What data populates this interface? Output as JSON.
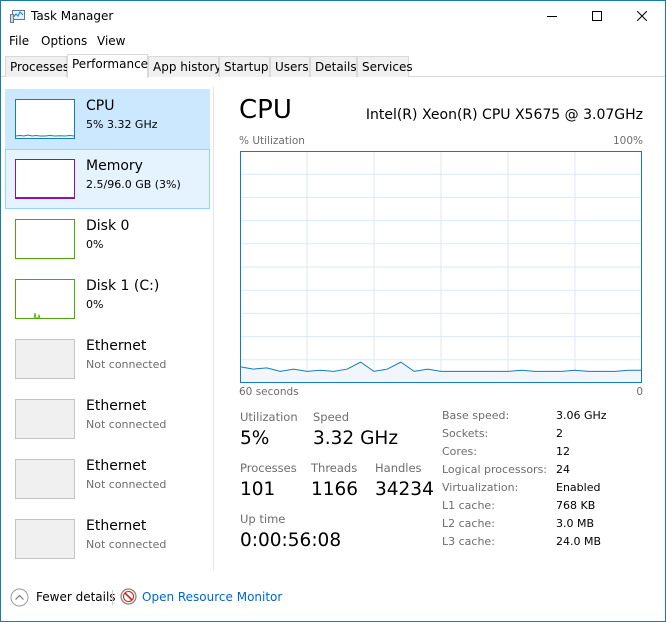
{
  "window": {
    "title": "Task Manager",
    "app_icon": "task-manager-icon",
    "controls": [
      "minimize-icon",
      "maximize-icon",
      "close-icon"
    ]
  },
  "menu": [
    "File",
    "Options",
    "View"
  ],
  "tabs": [
    {
      "label": "Processes",
      "active": false
    },
    {
      "label": "Performance",
      "active": true
    },
    {
      "label": "App history",
      "active": false
    },
    {
      "label": "Startup",
      "active": false
    },
    {
      "label": "Users",
      "active": false
    },
    {
      "label": "Details",
      "active": false
    },
    {
      "label": "Services",
      "active": false
    }
  ],
  "sidebar": {
    "items": [
      {
        "title": "CPU",
        "subtitle": "5% 3.32 GHz",
        "state": "selected",
        "color": "#117dbb"
      },
      {
        "title": "Memory",
        "subtitle": "2.5/96.0 GB (3%)",
        "state": "hover",
        "color": "#8b12ae"
      },
      {
        "title": "Disk 0",
        "subtitle": "0%",
        "state": "normal",
        "color": "#4da60c"
      },
      {
        "title": "Disk 1 (C:)",
        "subtitle": "0%",
        "state": "normal",
        "color": "#4da60c"
      },
      {
        "title": "Ethernet",
        "subtitle": "Not connected",
        "state": "disabled",
        "color": "#c4c4c4"
      },
      {
        "title": "Ethernet",
        "subtitle": "Not connected",
        "state": "disabled",
        "color": "#c4c4c4"
      },
      {
        "title": "Ethernet",
        "subtitle": "Not connected",
        "state": "disabled",
        "color": "#c4c4c4"
      },
      {
        "title": "Ethernet",
        "subtitle": "Not connected",
        "state": "disabled",
        "color": "#c4c4c4"
      }
    ]
  },
  "main": {
    "heading": "CPU",
    "model": "Intel(R) Xeon(R) CPU X5675 @ 3.07GHz",
    "graph": {
      "y_label": "% Utilization",
      "y_max_label": "100%",
      "x_left_label": "60 seconds",
      "x_right_label": "0",
      "line_color": "#117dbb",
      "fill_color": "#f1f6fa",
      "grid_color": "#d9eaf4"
    },
    "stats": {
      "utilization_label": "Utilization",
      "utilization_value": "5%",
      "speed_label": "Speed",
      "speed_value": "3.32 GHz",
      "processes_label": "Processes",
      "processes_value": "101",
      "threads_label": "Threads",
      "threads_value": "1166",
      "handles_label": "Handles",
      "handles_value": "34234",
      "uptime_label": "Up time",
      "uptime_value": "0:00:56:08"
    },
    "specs": [
      {
        "label": "Base speed:",
        "value": "3.06 GHz"
      },
      {
        "label": "Sockets:",
        "value": "2"
      },
      {
        "label": "Cores:",
        "value": "12"
      },
      {
        "label": "Logical processors:",
        "value": "24"
      },
      {
        "label": "Virtualization:",
        "value": "Enabled"
      },
      {
        "label": "L1 cache:",
        "value": "768 KB"
      },
      {
        "label": "L2 cache:",
        "value": "3.0 MB"
      },
      {
        "label": "L3 cache:",
        "value": "24.0 MB"
      }
    ]
  },
  "footer": {
    "fewer_details": "Fewer details",
    "open_resource_monitor": "Open Resource Monitor"
  },
  "chart_data": {
    "type": "area",
    "title": "CPU % Utilization",
    "xlabel": "60 seconds",
    "ylabel": "% Utilization",
    "x_range": [
      60,
      0
    ],
    "ylim": [
      0,
      100
    ],
    "grid": true,
    "x": [
      60,
      58,
      56,
      54,
      52,
      50,
      48,
      46,
      44,
      42,
      40,
      38,
      36,
      34,
      32,
      30,
      28,
      26,
      24,
      22,
      20,
      18,
      16,
      14,
      12,
      10,
      8,
      6,
      4,
      2,
      0
    ],
    "values": [
      7,
      6,
      6.5,
      5,
      6,
      5,
      5.5,
      5,
      6,
      9,
      5,
      6,
      9,
      5,
      6,
      5,
      5,
      5,
      5,
      5,
      5,
      5.5,
      5,
      5,
      5,
      5.5,
      5,
      5,
      5,
      5.5,
      5.5
    ]
  }
}
